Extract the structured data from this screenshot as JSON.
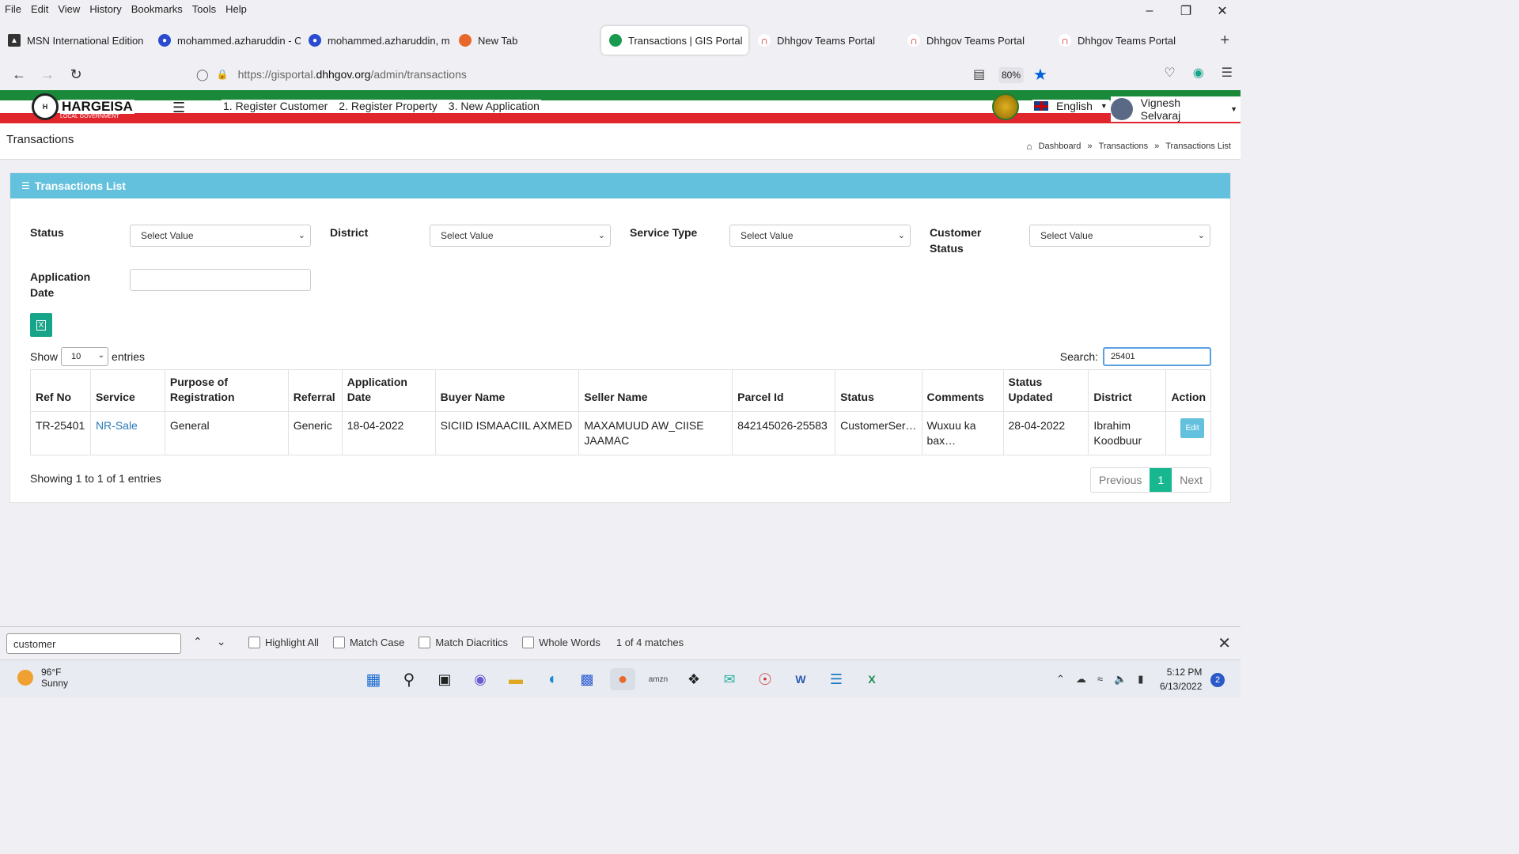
{
  "browser": {
    "menu": [
      "File",
      "Edit",
      "View",
      "History",
      "Bookmarks",
      "Tools",
      "Help"
    ],
    "tabs": [
      {
        "label": "MSN International Edition",
        "icon": "msn-icon",
        "color": "#333333"
      },
      {
        "label": "mohammed.azharuddin - C",
        "icon": "skype-icon",
        "color": "#2a4ad0"
      },
      {
        "label": "mohammed.azharuddin, m",
        "icon": "skype-icon",
        "color": "#2a4ad0"
      },
      {
        "label": "New Tab",
        "icon": "firefox-icon",
        "color": "#e8682a"
      },
      {
        "label": "Transactions | GIS Portal",
        "icon": "gis-portal-icon",
        "color": "#1a9a50",
        "active": true
      },
      {
        "label": "Dhhgov Teams Portal",
        "icon": "teams-portal-icon",
        "color": "#d02020"
      },
      {
        "label": "Dhhgov Teams Portal",
        "icon": "teams-portal-icon",
        "color": "#d02020"
      },
      {
        "label": "Dhhgov Teams Portal",
        "icon": "teams-portal-icon",
        "color": "#d02020"
      }
    ],
    "url_prefix": "https://gisportal.",
    "url_host": "dhhgov.org",
    "url_path": "/admin/transactions",
    "zoom": "80%"
  },
  "site": {
    "logo_text": "HARGEISA",
    "logo_sub": "LOCAL GOVERNMENT",
    "nav": [
      "1. Register Customer",
      "2. Register Property",
      "3. New Application"
    ],
    "language": "English",
    "user": "Vignesh Selvaraj"
  },
  "page": {
    "title": "Transactions",
    "breadcrumb": [
      "Dashboard",
      "Transactions",
      "Transactions List"
    ]
  },
  "card": {
    "title": "Transactions List",
    "filters": {
      "status_label": "Status",
      "district_label": "District",
      "service_type_label": "Service Type",
      "customer_status_label": "Customer Status",
      "application_date_label": "Application Date",
      "select_placeholder": "Select Value"
    },
    "show_label": "Show",
    "entries_value": "10",
    "entries_label": "entries",
    "search_label": "Search:",
    "search_value": "25401",
    "columns": [
      "Ref No",
      "Service",
      "Purpose of Registration",
      "Referral",
      "Application Date",
      "Buyer Name",
      "Seller Name",
      "Parcel Id",
      "Status",
      "Comments",
      "Status Updated",
      "District",
      "Action"
    ],
    "rows": [
      {
        "ref_no": "TR-25401",
        "service": "NR-Sale",
        "purpose": "General",
        "referral": "Generic",
        "application_date": "18-04-2022",
        "buyer": "SICIID ISMAACIIL AXMED",
        "seller": "MAXAMUUD AW_CIISE JAAMAC",
        "parcel_id": "842145026-25583",
        "status": "CustomerSer…",
        "comments": "Wuxuu ka bax…",
        "status_updated": "28-04-2022",
        "district": "Ibrahim Koodbuur",
        "action": "Edit"
      }
    ],
    "info": "Showing 1 to 1 of 1 entries",
    "pager": {
      "previous": "Previous",
      "current": "1",
      "next": "Next"
    }
  },
  "findbar": {
    "query": "customer",
    "options": [
      "Highlight All",
      "Match Case",
      "Match Diacritics",
      "Whole Words"
    ],
    "result": "1 of 4 matches"
  },
  "taskbar": {
    "temp": "96°F",
    "condition": "Sunny",
    "time": "5:12 PM",
    "date": "6/13/2022",
    "notifications": "2"
  },
  "colors": {
    "card_header": "#63c1dd",
    "green_stripe": "#1a8a3a",
    "red_stripe": "#e0262c",
    "pager_active": "#17b890"
  }
}
